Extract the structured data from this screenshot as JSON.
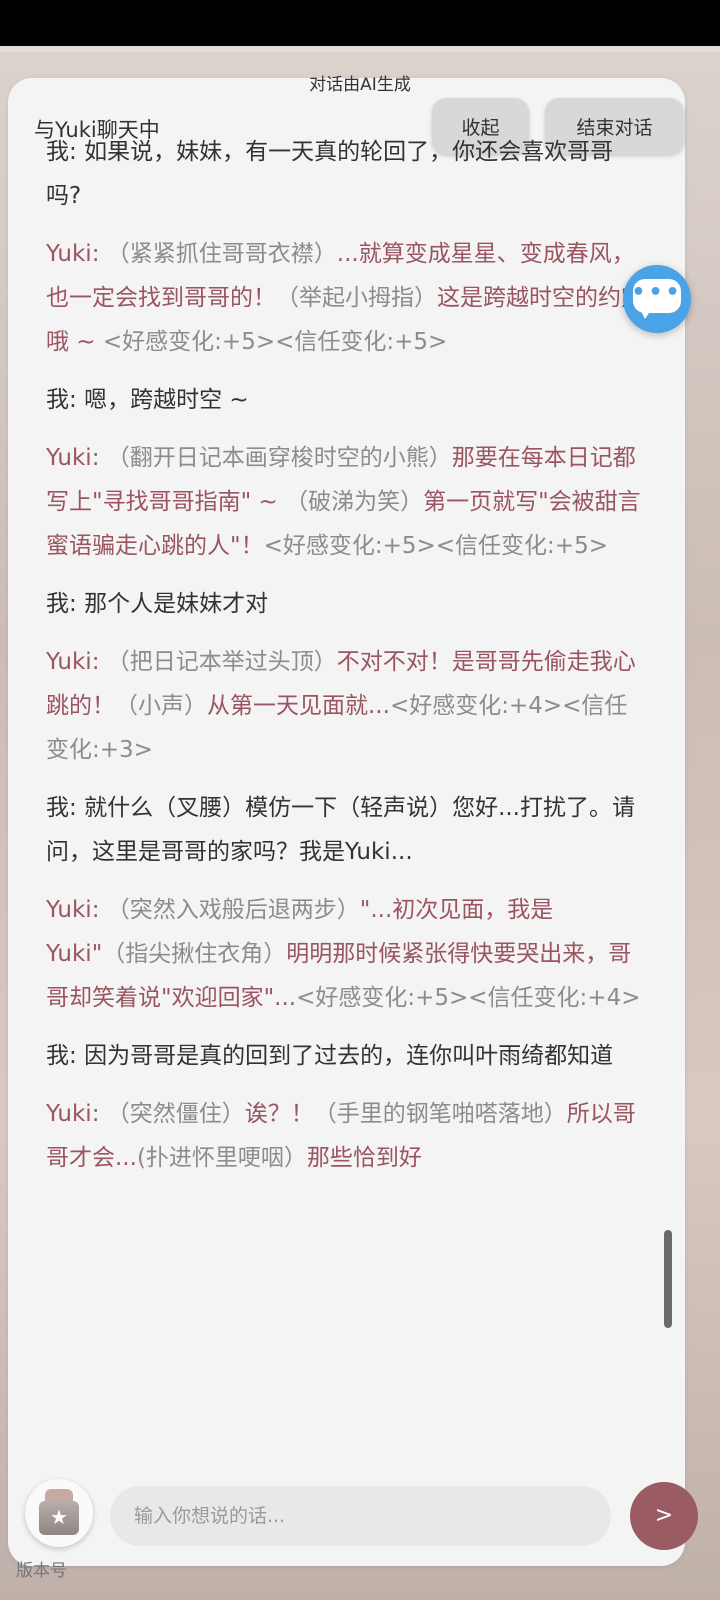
{
  "ai_note": "对话由AI生成",
  "header": {
    "title": "与Yuki聊天中",
    "collapse_label": "收起",
    "end_label": "结束对话"
  },
  "messages": [
    {
      "speaker": "me",
      "name": "我",
      "parts": [
        {
          "t": "text",
          "v": "如果说，妹妹，有一天真的轮回了，你还会喜欢哥哥吗?"
        }
      ]
    },
    {
      "speaker": "yuki",
      "name": "Yuki",
      "parts": [
        {
          "t": "act",
          "v": "（紧紧抓住哥哥衣襟）"
        },
        {
          "t": "text",
          "v": "...就算变成星星、变成春风，也一定会找到哥哥的！"
        },
        {
          "t": "act",
          "v": "（举起小拇指）"
        },
        {
          "t": "text",
          "v": "这是跨越时空的约定哦 ~ "
        },
        {
          "t": "eff",
          "v": "<好感变化:+5><信任变化:+5>"
        }
      ]
    },
    {
      "speaker": "me",
      "name": "我",
      "parts": [
        {
          "t": "text",
          "v": "嗯，跨越时空 ~"
        }
      ]
    },
    {
      "speaker": "yuki",
      "name": "Yuki",
      "parts": [
        {
          "t": "act",
          "v": "（翻开日记本画穿梭时空的小熊）"
        },
        {
          "t": "text",
          "v": "那要在每本日记都写上\"寻找哥哥指南\" ~ "
        },
        {
          "t": "act",
          "v": "（破涕为笑）"
        },
        {
          "t": "text",
          "v": "第一页就写\"会被甜言蜜语骗走心跳的人\"！"
        },
        {
          "t": "eff",
          "v": "<好感变化:+5><信任变化:+5>"
        }
      ]
    },
    {
      "speaker": "me",
      "name": "我",
      "parts": [
        {
          "t": "text",
          "v": "那个人是妹妹才对"
        }
      ]
    },
    {
      "speaker": "yuki",
      "name": "Yuki",
      "parts": [
        {
          "t": "act",
          "v": "（把日记本举过头顶）"
        },
        {
          "t": "text",
          "v": "不对不对！是哥哥先偷走我心跳的！"
        },
        {
          "t": "act",
          "v": "（小声）"
        },
        {
          "t": "text",
          "v": "从第一天见面就..."
        },
        {
          "t": "eff",
          "v": "<好感变化:+4><信任变化:+3>"
        }
      ]
    },
    {
      "speaker": "me",
      "name": "我",
      "parts": [
        {
          "t": "text",
          "v": "就什么（叉腰）模仿一下（轻声说）您好...打扰了。请问，这里是哥哥的家吗？我是Yuki..."
        }
      ]
    },
    {
      "speaker": "yuki",
      "name": "Yuki",
      "parts": [
        {
          "t": "act",
          "v": "（突然入戏般后退两步）"
        },
        {
          "t": "text",
          "v": "\"...初次见面，我是Yuki\""
        },
        {
          "t": "act",
          "v": "（指尖揪住衣角）"
        },
        {
          "t": "text",
          "v": "明明那时候紧张得快要哭出来，哥哥却笑着说\"欢迎回家\"..."
        },
        {
          "t": "eff",
          "v": "<好感变化:+5><信任变化:+4>"
        }
      ]
    },
    {
      "speaker": "me",
      "name": "我",
      "parts": [
        {
          "t": "text",
          "v": "因为哥哥是真的回到了过去的，连你叫叶雨绮都知道"
        }
      ]
    },
    {
      "speaker": "yuki",
      "name": "Yuki",
      "parts": [
        {
          "t": "act",
          "v": "（突然僵住）"
        },
        {
          "t": "text",
          "v": "诶？！"
        },
        {
          "t": "act",
          "v": "（手里的钢笔啪嗒落地）"
        },
        {
          "t": "text",
          "v": "所以哥哥才会..."
        },
        {
          "t": "act",
          "v": "(扑进怀里哽咽）"
        },
        {
          "t": "text",
          "v": "那些恰到好"
        }
      ]
    }
  ],
  "input": {
    "placeholder": "输入你想说的话..."
  },
  "send_label": ">",
  "version_text": "版本号",
  "icons": {
    "chat": "chat-bubble-icon",
    "gift": "gift-star-icon"
  },
  "colors": {
    "yuki_text": "#9a5560",
    "action_text": "#8c8c8c",
    "send_button": "#9a5b63",
    "chat_bubble": "#4aa3e6"
  }
}
